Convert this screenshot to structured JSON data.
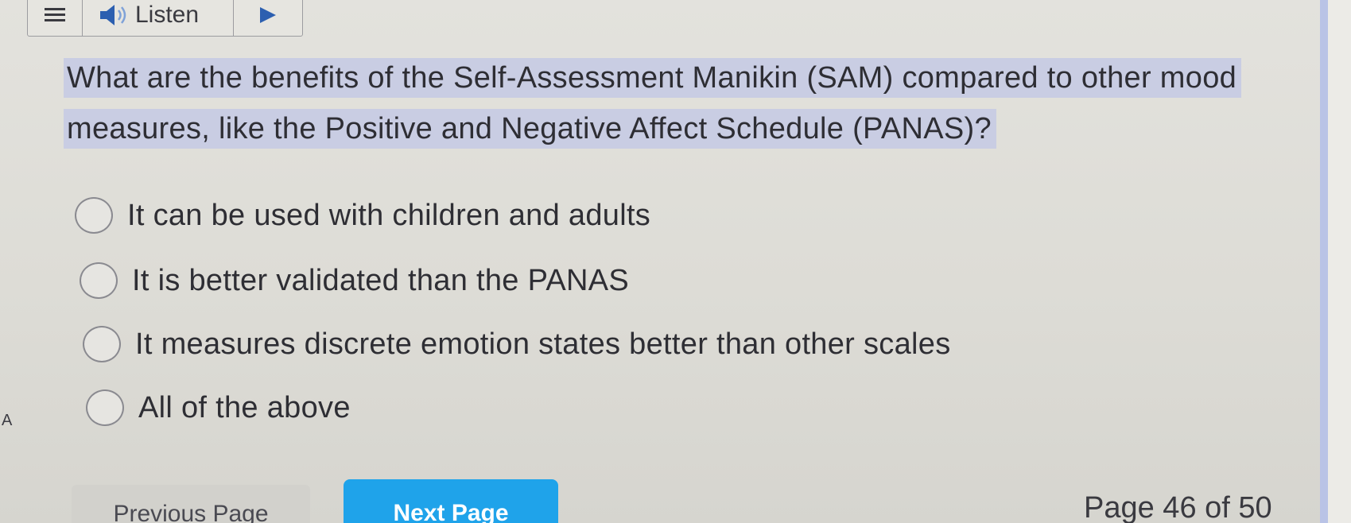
{
  "toolbar": {
    "menu_icon": "hamburger-icon",
    "speaker_icon": "speaker-icon",
    "listen_label": "Listen",
    "play_icon": "play-icon"
  },
  "question": {
    "text": "What are the benefits of the Self-Assessment Manikin (SAM) compared to other mood measures, like the Positive and Negative Affect Schedule (PANAS)?"
  },
  "options": [
    {
      "label": "It can be used with children and adults",
      "selected": false
    },
    {
      "label": "It is better validated than the PANAS",
      "selected": false
    },
    {
      "label": "It measures discrete emotion states better than other scales",
      "selected": false
    },
    {
      "label": "All of the above",
      "selected": false
    }
  ],
  "side_marker": "A",
  "navigation": {
    "previous_label": "Previous Page",
    "next_label": "Next Page",
    "page_indicator": "Page 46 of 50"
  },
  "colors": {
    "highlight": "#c9cde3",
    "next_button": "#1fa3ea",
    "right_accent": "#b9c3e6"
  }
}
